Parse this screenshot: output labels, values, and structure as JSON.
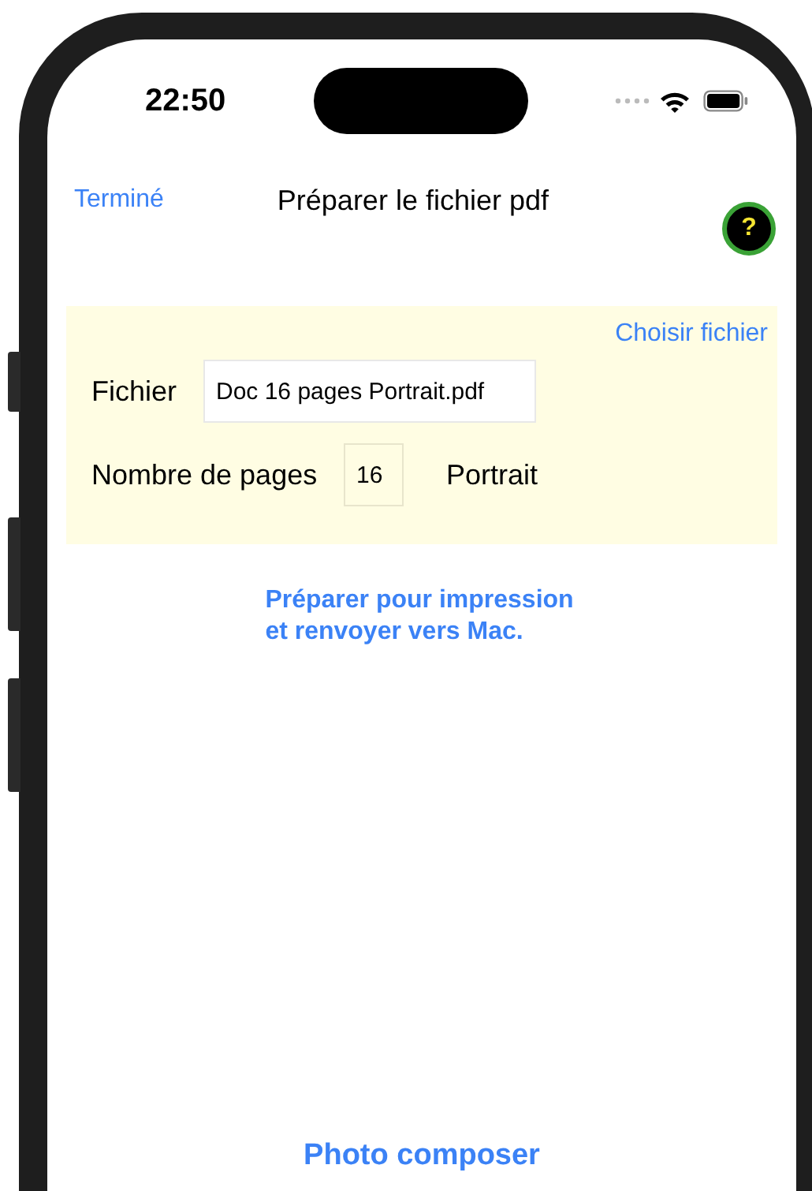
{
  "status_bar": {
    "time": "22:50"
  },
  "nav": {
    "done": "Terminé",
    "title": "Préparer le fichier pdf",
    "help": "?"
  },
  "file_panel": {
    "choose": "Choisir fichier",
    "file_label": "Fichier",
    "file_value": "Doc 16 pages Portrait.pdf",
    "pages_label": "Nombre de pages",
    "pages_value": "16",
    "orientation": "Portrait"
  },
  "action_button": "Préparer pour impression\net renvoyer vers Mac.",
  "bottom_button": "Photo composer"
}
